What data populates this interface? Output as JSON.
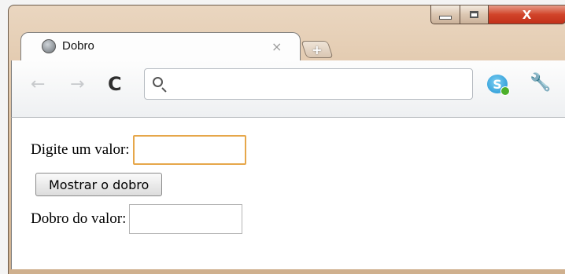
{
  "window": {
    "controls": {
      "minimize": "minimize",
      "maximize": "maximize",
      "close": "X"
    }
  },
  "tab": {
    "title": "Dobro",
    "close_glyph": "×",
    "new_tab_glyph": "+"
  },
  "toolbar": {
    "back_glyph": "←",
    "forward_glyph": "→",
    "reload_glyph": "C",
    "address": {
      "value": "",
      "placeholder": ""
    },
    "extension_icon": "skype-icon",
    "menu_icon": "wrench-icon"
  },
  "form": {
    "input_label": "Digite um valor:",
    "input_value": "",
    "button_label": "Mostrar o dobro",
    "output_label": "Dobro do valor:",
    "output_value": ""
  },
  "colors": {
    "focus_border": "#e6a74a",
    "close_button": "#d1442a"
  }
}
